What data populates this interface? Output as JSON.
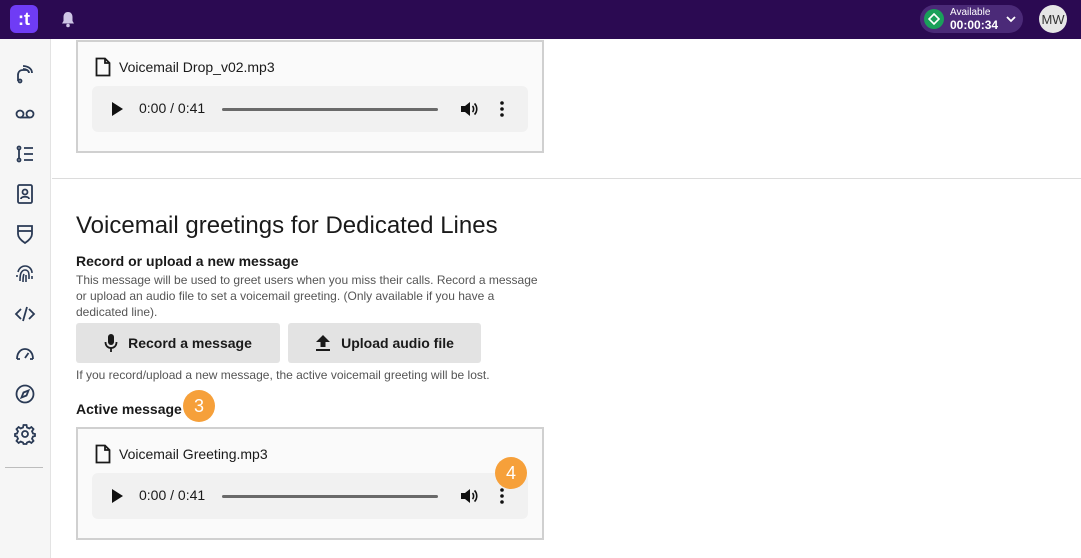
{
  "topbar": {
    "logo_glyph": ":t",
    "status": {
      "label": "Available",
      "timer": "00:00:34",
      "color": "#1aa05a"
    },
    "avatar_initials": "MW"
  },
  "sidebar": {
    "items": [
      {
        "icon": "calls-icon"
      },
      {
        "icon": "voicemail-icon"
      },
      {
        "icon": "list-icon"
      },
      {
        "icon": "contacts-icon"
      },
      {
        "icon": "shield-icon"
      },
      {
        "icon": "fingerprint-icon"
      },
      {
        "icon": "code-icon"
      },
      {
        "icon": "gauge-icon"
      },
      {
        "icon": "compass-icon"
      },
      {
        "icon": "gear-icon"
      }
    ]
  },
  "previous_card": {
    "file_name": "Voicemail Drop_v02.mp3",
    "player_time": "0:00 / 0:41"
  },
  "section": {
    "title": "Voicemail greetings for Dedicated Lines",
    "record_heading": "Record or upload a new message",
    "description": "This message will be used to greet users when you miss their calls. Record a message or upload an audio file to set a voicemail greeting. (Only available if you have a dedicated line).",
    "record_button": "Record a message",
    "upload_button": "Upload audio file",
    "warning": "If you record/upload a new message, the active voicemail greeting will be lost.",
    "active_heading": "Active message"
  },
  "active_card": {
    "file_name": "Voicemail Greeting.mp3",
    "player_time": "0:00 / 0:41"
  },
  "badges": {
    "active_message": "3",
    "player_menu": "4",
    "color": "#f6a03a"
  },
  "colors": {
    "topbar": "#2b0a52",
    "logo": "#6f3cf5"
  }
}
